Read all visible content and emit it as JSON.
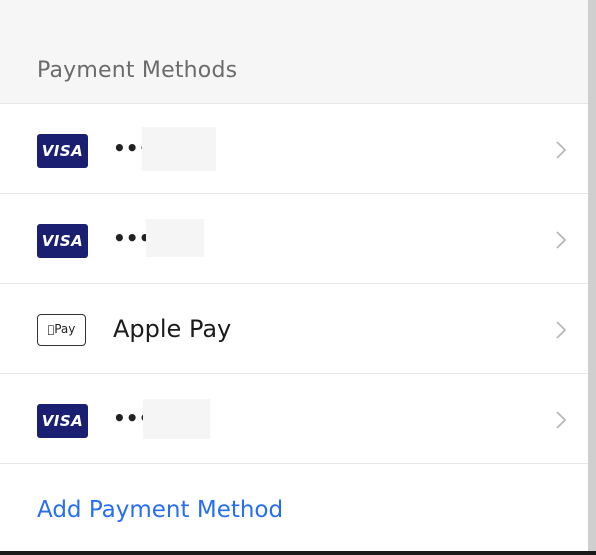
{
  "header": {
    "title": "Payment Methods"
  },
  "payment_methods": [
    {
      "brand": "VISA",
      "icon": "visa-card-icon",
      "masked_number": "••••"
    },
    {
      "brand": "VISA",
      "icon": "visa-card-icon",
      "masked_number": "••••"
    },
    {
      "brand": "Pay",
      "icon": "apple-pay-icon",
      "label": "Apple Pay"
    },
    {
      "brand": "VISA",
      "icon": "visa-card-icon",
      "masked_number": "••••"
    }
  ],
  "actions": {
    "add_payment_method": "Add Payment Method"
  },
  "colors": {
    "header_bg": "#f6f6f6",
    "visa_blue": "#1a1f71",
    "link_blue": "#276ef1",
    "divider": "#e6e6e6"
  }
}
